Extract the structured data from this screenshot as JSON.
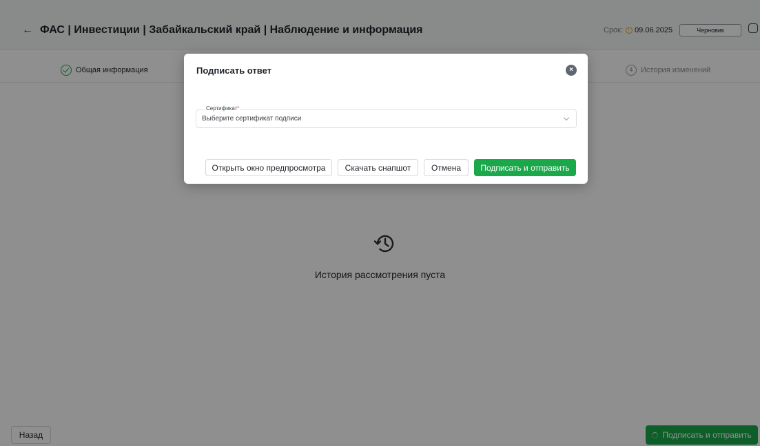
{
  "header": {
    "back_icon": "←",
    "title": "ФАС | Инвестиции | Забайкальский край | Наблюдение и информация",
    "deadline_label": "Срок:",
    "deadline_date": "09.06.2025",
    "status": "Черновик",
    "accent_color": "#1aa84b",
    "warning_color": "#f2a60c"
  },
  "steps": [
    {
      "label": "Общая информация",
      "state": "done"
    },
    {
      "number": "4",
      "label": "История изменений",
      "state": "pending"
    }
  ],
  "empty_state": {
    "icon": "history-icon",
    "text": "История рассмотрения пуста"
  },
  "footer": {
    "back_label": "Назад",
    "submit_label": "Подписать и отправить"
  },
  "modal": {
    "title": "Подписать ответ",
    "close_icon": "×",
    "certificate": {
      "label": "Сертификат",
      "required_mark": "*",
      "placeholder": "Выберите сертификат подписи"
    },
    "buttons": {
      "preview": "Открыть окно предпросмотра",
      "snapshot": "Скачать снапшот",
      "cancel": "Отмена",
      "sign": "Подписать и отправить"
    }
  }
}
